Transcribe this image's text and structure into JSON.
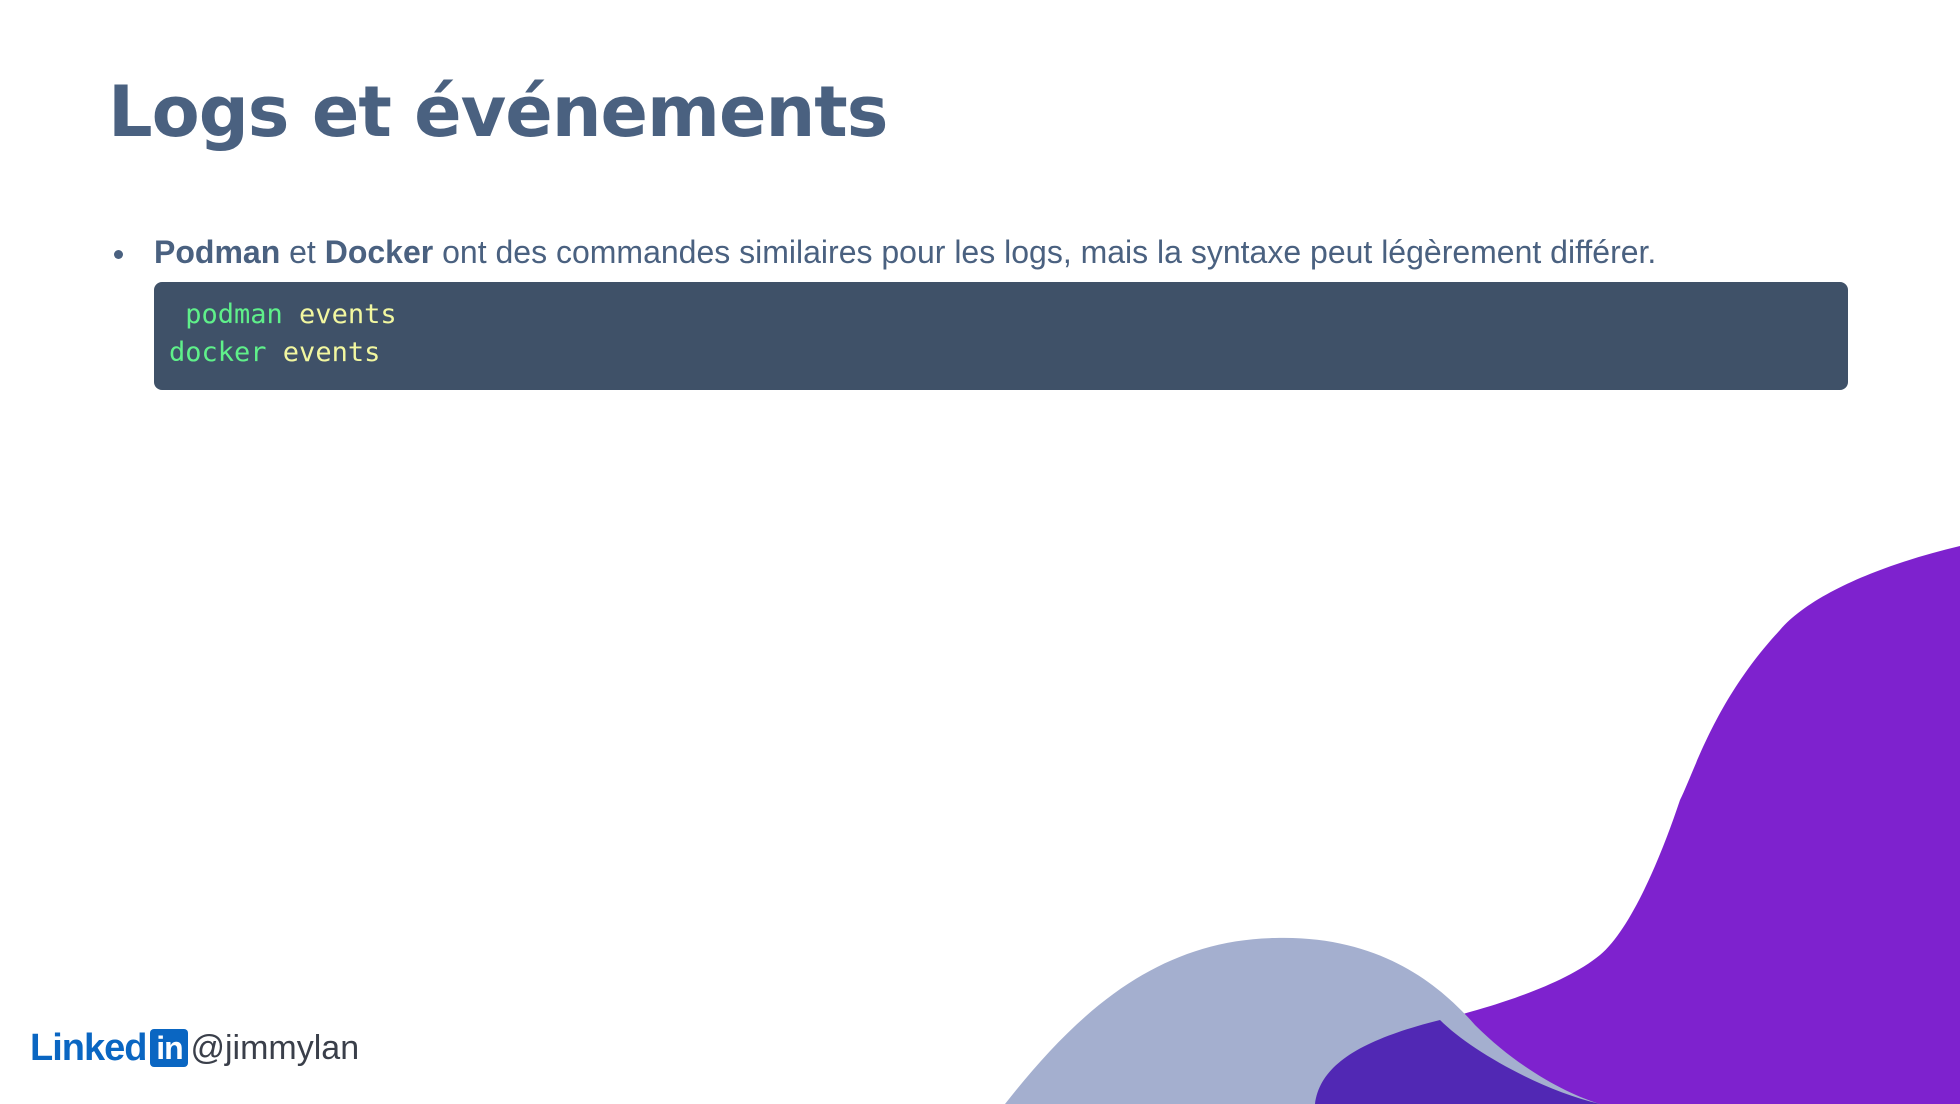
{
  "slide": {
    "title": "Logs et événements"
  },
  "bullets": [
    {
      "bold1": "Podman",
      "connector": " et ",
      "bold2": "Docker",
      "rest": " ont des commandes similaires pour les logs, mais la syntaxe peut légèrement différer."
    }
  ],
  "code": {
    "lines": [
      {
        "cmd": " podman",
        "arg": " events"
      },
      {
        "cmd": "docker",
        "arg": " events"
      }
    ]
  },
  "footer": {
    "brand_text": "Linked",
    "brand_box": "in",
    "handle": "@jimmylan",
    "icon": "linkedin-logo"
  },
  "colors": {
    "text": "#4a6180",
    "code_bg": "#3f5168",
    "code_cmd": "#5ff08a",
    "code_arg": "#f2f7a0",
    "wave_purple": "#7e22ce",
    "wave_gray": "#a4afcf",
    "wave_overlap": "#5128b4",
    "linkedin_blue": "#0a66c2"
  }
}
